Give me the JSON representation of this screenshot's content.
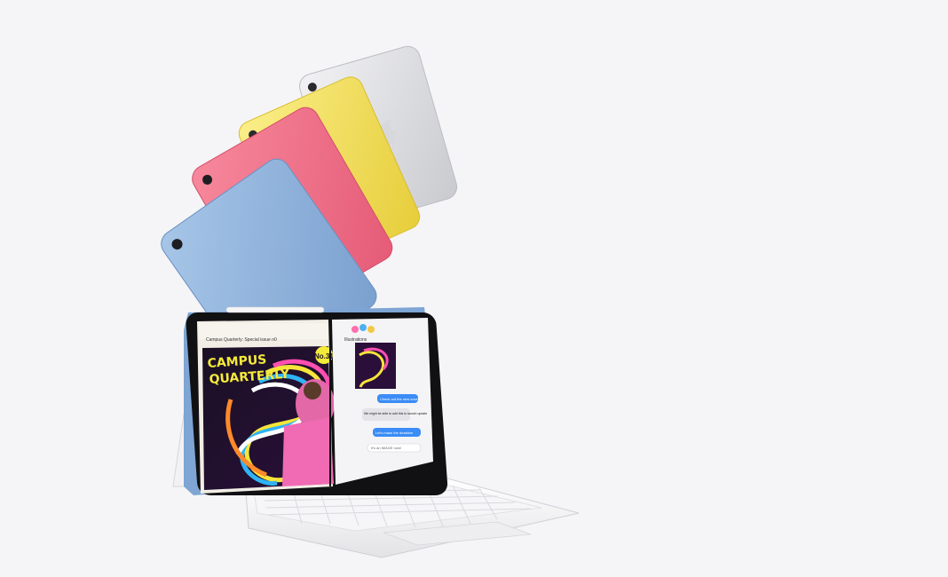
{
  "scene": {
    "background": "#f5f5f7",
    "ipad_colors": [
      "#dcdde2",
      "#f3e05c",
      "#f0728a",
      "#8fb3dc"
    ],
    "screen": {
      "left_app": {
        "title": "Campus Quarterly: Special issue n0",
        "poster_line1": "CAMPUS",
        "poster_line2": "QUARTERLY",
        "badge": "No.31"
      },
      "right_app": {
        "header": "Illustrations",
        "messages": [
          "Check out the new cover!",
          "We might be able to add this to launch update",
          "Let's make the deadline"
        ],
        "input_placeholder": "It's an IMAGE now!"
      }
    }
  }
}
